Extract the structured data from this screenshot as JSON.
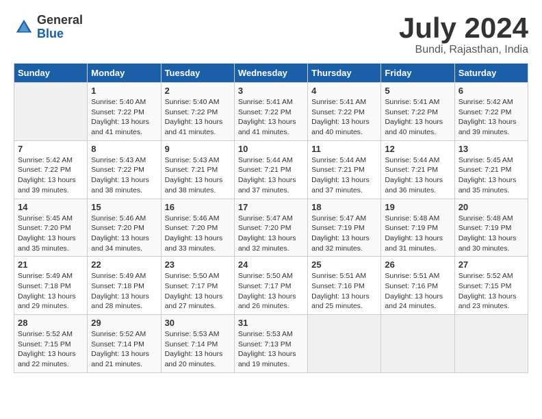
{
  "header": {
    "logo_general": "General",
    "logo_blue": "Blue",
    "month_title": "July 2024",
    "location": "Bundi, Rajasthan, India"
  },
  "days_of_week": [
    "Sunday",
    "Monday",
    "Tuesday",
    "Wednesday",
    "Thursday",
    "Friday",
    "Saturday"
  ],
  "weeks": [
    [
      {
        "day": "",
        "sunrise": "",
        "sunset": "",
        "daylight": ""
      },
      {
        "day": "1",
        "sunrise": "Sunrise: 5:40 AM",
        "sunset": "Sunset: 7:22 PM",
        "daylight": "Daylight: 13 hours and 41 minutes."
      },
      {
        "day": "2",
        "sunrise": "Sunrise: 5:40 AM",
        "sunset": "Sunset: 7:22 PM",
        "daylight": "Daylight: 13 hours and 41 minutes."
      },
      {
        "day": "3",
        "sunrise": "Sunrise: 5:41 AM",
        "sunset": "Sunset: 7:22 PM",
        "daylight": "Daylight: 13 hours and 41 minutes."
      },
      {
        "day": "4",
        "sunrise": "Sunrise: 5:41 AM",
        "sunset": "Sunset: 7:22 PM",
        "daylight": "Daylight: 13 hours and 40 minutes."
      },
      {
        "day": "5",
        "sunrise": "Sunrise: 5:41 AM",
        "sunset": "Sunset: 7:22 PM",
        "daylight": "Daylight: 13 hours and 40 minutes."
      },
      {
        "day": "6",
        "sunrise": "Sunrise: 5:42 AM",
        "sunset": "Sunset: 7:22 PM",
        "daylight": "Daylight: 13 hours and 39 minutes."
      }
    ],
    [
      {
        "day": "7",
        "sunrise": "Sunrise: 5:42 AM",
        "sunset": "Sunset: 7:22 PM",
        "daylight": "Daylight: 13 hours and 39 minutes."
      },
      {
        "day": "8",
        "sunrise": "Sunrise: 5:43 AM",
        "sunset": "Sunset: 7:22 PM",
        "daylight": "Daylight: 13 hours and 38 minutes."
      },
      {
        "day": "9",
        "sunrise": "Sunrise: 5:43 AM",
        "sunset": "Sunset: 7:21 PM",
        "daylight": "Daylight: 13 hours and 38 minutes."
      },
      {
        "day": "10",
        "sunrise": "Sunrise: 5:44 AM",
        "sunset": "Sunset: 7:21 PM",
        "daylight": "Daylight: 13 hours and 37 minutes."
      },
      {
        "day": "11",
        "sunrise": "Sunrise: 5:44 AM",
        "sunset": "Sunset: 7:21 PM",
        "daylight": "Daylight: 13 hours and 37 minutes."
      },
      {
        "day": "12",
        "sunrise": "Sunrise: 5:44 AM",
        "sunset": "Sunset: 7:21 PM",
        "daylight": "Daylight: 13 hours and 36 minutes."
      },
      {
        "day": "13",
        "sunrise": "Sunrise: 5:45 AM",
        "sunset": "Sunset: 7:21 PM",
        "daylight": "Daylight: 13 hours and 35 minutes."
      }
    ],
    [
      {
        "day": "14",
        "sunrise": "Sunrise: 5:45 AM",
        "sunset": "Sunset: 7:20 PM",
        "daylight": "Daylight: 13 hours and 35 minutes."
      },
      {
        "day": "15",
        "sunrise": "Sunrise: 5:46 AM",
        "sunset": "Sunset: 7:20 PM",
        "daylight": "Daylight: 13 hours and 34 minutes."
      },
      {
        "day": "16",
        "sunrise": "Sunrise: 5:46 AM",
        "sunset": "Sunset: 7:20 PM",
        "daylight": "Daylight: 13 hours and 33 minutes."
      },
      {
        "day": "17",
        "sunrise": "Sunrise: 5:47 AM",
        "sunset": "Sunset: 7:20 PM",
        "daylight": "Daylight: 13 hours and 32 minutes."
      },
      {
        "day": "18",
        "sunrise": "Sunrise: 5:47 AM",
        "sunset": "Sunset: 7:19 PM",
        "daylight": "Daylight: 13 hours and 32 minutes."
      },
      {
        "day": "19",
        "sunrise": "Sunrise: 5:48 AM",
        "sunset": "Sunset: 7:19 PM",
        "daylight": "Daylight: 13 hours and 31 minutes."
      },
      {
        "day": "20",
        "sunrise": "Sunrise: 5:48 AM",
        "sunset": "Sunset: 7:19 PM",
        "daylight": "Daylight: 13 hours and 30 minutes."
      }
    ],
    [
      {
        "day": "21",
        "sunrise": "Sunrise: 5:49 AM",
        "sunset": "Sunset: 7:18 PM",
        "daylight": "Daylight: 13 hours and 29 minutes."
      },
      {
        "day": "22",
        "sunrise": "Sunrise: 5:49 AM",
        "sunset": "Sunset: 7:18 PM",
        "daylight": "Daylight: 13 hours and 28 minutes."
      },
      {
        "day": "23",
        "sunrise": "Sunrise: 5:50 AM",
        "sunset": "Sunset: 7:17 PM",
        "daylight": "Daylight: 13 hours and 27 minutes."
      },
      {
        "day": "24",
        "sunrise": "Sunrise: 5:50 AM",
        "sunset": "Sunset: 7:17 PM",
        "daylight": "Daylight: 13 hours and 26 minutes."
      },
      {
        "day": "25",
        "sunrise": "Sunrise: 5:51 AM",
        "sunset": "Sunset: 7:16 PM",
        "daylight": "Daylight: 13 hours and 25 minutes."
      },
      {
        "day": "26",
        "sunrise": "Sunrise: 5:51 AM",
        "sunset": "Sunset: 7:16 PM",
        "daylight": "Daylight: 13 hours and 24 minutes."
      },
      {
        "day": "27",
        "sunrise": "Sunrise: 5:52 AM",
        "sunset": "Sunset: 7:15 PM",
        "daylight": "Daylight: 13 hours and 23 minutes."
      }
    ],
    [
      {
        "day": "28",
        "sunrise": "Sunrise: 5:52 AM",
        "sunset": "Sunset: 7:15 PM",
        "daylight": "Daylight: 13 hours and 22 minutes."
      },
      {
        "day": "29",
        "sunrise": "Sunrise: 5:52 AM",
        "sunset": "Sunset: 7:14 PM",
        "daylight": "Daylight: 13 hours and 21 minutes."
      },
      {
        "day": "30",
        "sunrise": "Sunrise: 5:53 AM",
        "sunset": "Sunset: 7:14 PM",
        "daylight": "Daylight: 13 hours and 20 minutes."
      },
      {
        "day": "31",
        "sunrise": "Sunrise: 5:53 AM",
        "sunset": "Sunset: 7:13 PM",
        "daylight": "Daylight: 13 hours and 19 minutes."
      },
      {
        "day": "",
        "sunrise": "",
        "sunset": "",
        "daylight": ""
      },
      {
        "day": "",
        "sunrise": "",
        "sunset": "",
        "daylight": ""
      },
      {
        "day": "",
        "sunrise": "",
        "sunset": "",
        "daylight": ""
      }
    ]
  ]
}
